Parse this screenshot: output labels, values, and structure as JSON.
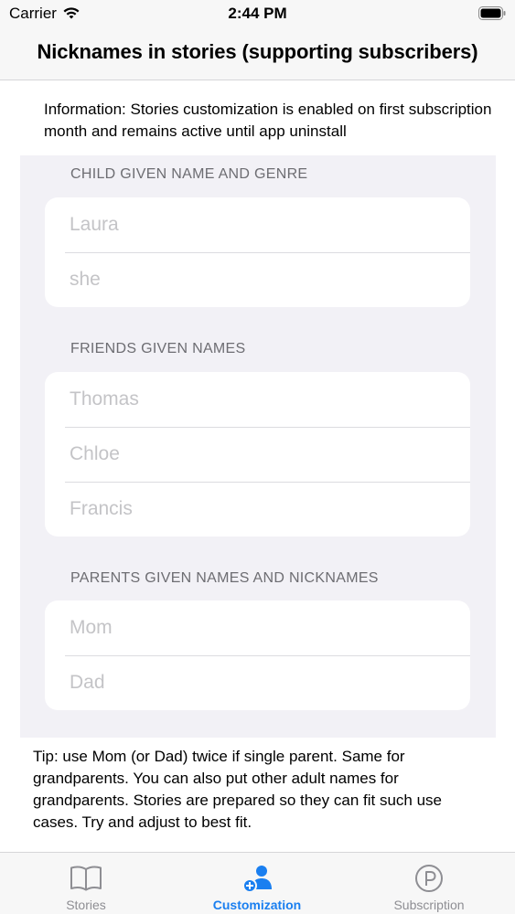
{
  "status_bar": {
    "carrier": "Carrier",
    "time": "2:44 PM"
  },
  "nav": {
    "title": "Nicknames in stories (supporting subscribers)"
  },
  "info": "Information: Stories customization is enabled on first subscription month and remains active until app uninstall",
  "sections": {
    "child": {
      "header": "CHILD GIVEN NAME AND GENRE",
      "fields": [
        {
          "placeholder": "Laura"
        },
        {
          "placeholder": "she"
        }
      ]
    },
    "friends": {
      "header": "FRIENDS GIVEN NAMES",
      "fields": [
        {
          "placeholder": "Thomas"
        },
        {
          "placeholder": "Chloe"
        },
        {
          "placeholder": "Francis"
        }
      ]
    },
    "parents": {
      "header": "PARENTS GIVEN NAMES AND NICKNAMES",
      "fields": [
        {
          "placeholder": "Mom"
        },
        {
          "placeholder": "Dad"
        }
      ]
    }
  },
  "tip": "Tip: use Mom (or Dad) twice if single parent. Same for grandparents. You can also put other adult names for grandparents. Stories are prepared so they can fit such use cases. Try and adjust to best fit.",
  "tabs": [
    {
      "label": "Stories",
      "icon": "book-icon",
      "active": false
    },
    {
      "label": "Customization",
      "icon": "person-add-icon",
      "active": true
    },
    {
      "label": "Subscription",
      "icon": "coin-icon",
      "active": false
    }
  ],
  "colors": {
    "accent": "#1a7ff0",
    "inactive": "#8e8e93",
    "form_background": "#f2f1f6"
  }
}
